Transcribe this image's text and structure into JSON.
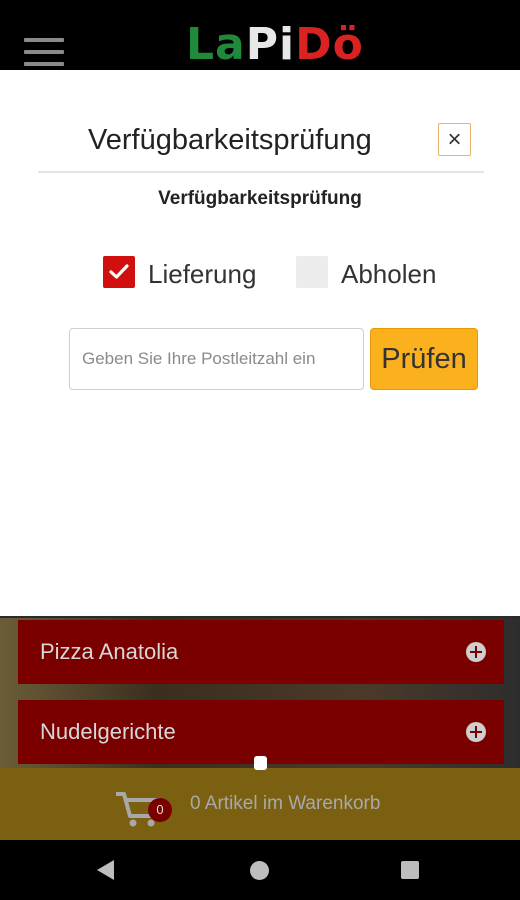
{
  "header": {
    "logo": {
      "part1": "La",
      "part2": "Pi",
      "part3": "Dö"
    }
  },
  "modal": {
    "title": "Verfügbarkeitsprüfung",
    "close_symbol": "×",
    "subtitle": "Verfügbarkeitsprüfung",
    "options": [
      {
        "label": "Lieferung",
        "checked": true
      },
      {
        "label": "Abholen",
        "checked": false
      }
    ],
    "zip": {
      "placeholder": "Geben Sie Ihre Postleitzahl ein",
      "value": ""
    },
    "check_button": "Prüfen"
  },
  "categories": [
    {
      "label": "Pizza Anatolia"
    },
    {
      "label": "Nudelgerichte"
    }
  ],
  "cart": {
    "count": "0",
    "text": "0 Artikel im Warenkorb"
  },
  "colors": {
    "accent_red": "#d10f0f",
    "button_orange": "#fbb01e",
    "category_bg": "#7a0000"
  },
  "icons": [
    "menu-icon",
    "close-icon",
    "checkmark-icon",
    "plus-circle-icon",
    "cart-icon",
    "back-icon",
    "home-icon",
    "recents-icon"
  ]
}
